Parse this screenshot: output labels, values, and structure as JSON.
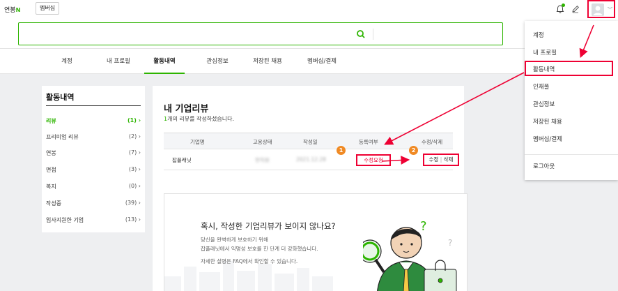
{
  "topbar": {
    "brand": "연봉",
    "brand_badge": "N",
    "membership_button": "멤버십"
  },
  "search": {
    "placeholder": ""
  },
  "tabs": [
    {
      "label": "계정"
    },
    {
      "label": "내 프로필"
    },
    {
      "label": "활동내역",
      "active": true
    },
    {
      "label": "관심정보"
    },
    {
      "label": "저장된 채용"
    },
    {
      "label": "멤버십/결제"
    }
  ],
  "sidebar": {
    "title": "활동내역",
    "items": [
      {
        "label": "리뷰",
        "count": "(1)",
        "active": true
      },
      {
        "label": "프리미엄 리뷰",
        "count": "(2)"
      },
      {
        "label": "연봉",
        "count": "(7)"
      },
      {
        "label": "면접",
        "count": "(3)"
      },
      {
        "label": "복지",
        "count": "(0)"
      },
      {
        "label": "작성중",
        "count": "(39)"
      },
      {
        "label": "입사지원한 기업",
        "count": "(13)"
      }
    ]
  },
  "main": {
    "title": "내 기업리뷰",
    "subtitle_count": "1",
    "subtitle_rest": "개의 리뷰를 작성하셨습니다.",
    "table": {
      "headers": [
        "기업명",
        "고용상태",
        "작성일",
        "등록여부",
        "수정/삭제"
      ],
      "row": {
        "company": "잡플래닛",
        "employment": "현직원",
        "date": "2021.12.28",
        "status": "수정요청",
        "edit": "수정",
        "divider": "|",
        "delete": "삭제"
      }
    },
    "badges": [
      "1",
      "2"
    ],
    "promo": {
      "title": "혹시, 작성한 기업리뷰가 보이지 않나요?",
      "line1": "당신을 완벽하게 보호하기 위해",
      "line2": "잡플래닛에서 익명성 보호를 한 단계 더 강화했습니다.",
      "line3": "자세한 설명은 FAQ에서 확인할 수 있습니다."
    }
  },
  "dropdown": {
    "items": [
      "계정",
      "내 프로필",
      "활동내역",
      "인재풀",
      "관심정보",
      "저장된 채용",
      "멤버십/결제"
    ],
    "logout": "로그아웃"
  },
  "colors": {
    "accent": "#2db400",
    "highlight": "#e00033",
    "badge": "#f08a24"
  }
}
